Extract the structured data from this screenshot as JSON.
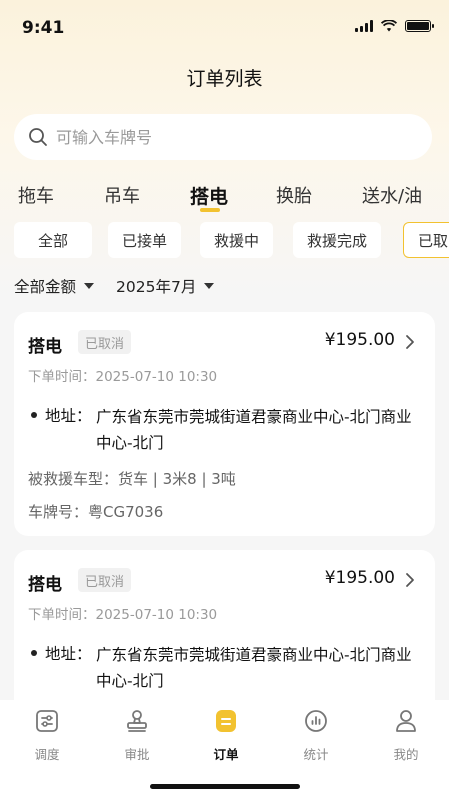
{
  "status_bar": {
    "time": "9:41"
  },
  "nav": {
    "title": "订单列表"
  },
  "search": {
    "placeholder": "可输入车牌号"
  },
  "service_tabs": [
    "拖车",
    "吊车",
    "搭电",
    "换胎",
    "送水/油"
  ],
  "active_service_tab": "搭电",
  "status_chips": [
    "全部",
    "已接单",
    "救援中",
    "救援完成",
    "已取"
  ],
  "active_status_chip": "已取",
  "filters": {
    "amount": "全部金额",
    "month": "2025年7月"
  },
  "orders": [
    {
      "type": "搭电",
      "status": "已取消",
      "price": "¥195.00",
      "order_time": "下单时间：2025-07-10 10:30",
      "address_label": "地址：",
      "address": "广东省东莞市莞城街道君豪商业中心-北门商业中心-北门",
      "vehicle_type": "被救援车型：货车 | 3米8 | 3吨",
      "plate": "车牌号：粤CG7036"
    },
    {
      "type": "搭电",
      "status": "已取消",
      "price": "¥195.00",
      "order_time": "下单时间：2025-07-10 10:30",
      "address_label": "地址：",
      "address": "广东省东莞市莞城街道君豪商业中心-北门商业中心-北门"
    }
  ],
  "tabbar": {
    "items": [
      {
        "label": "调度",
        "icon": "dispatch-icon"
      },
      {
        "label": "审批",
        "icon": "stamp-icon"
      },
      {
        "label": "订单",
        "icon": "order-icon"
      },
      {
        "label": "统计",
        "icon": "chart-icon"
      },
      {
        "label": "我的",
        "icon": "user-icon"
      }
    ],
    "active": "订单"
  },
  "colors": {
    "accent": "#f2c230",
    "muted": "#9a9a9a"
  }
}
